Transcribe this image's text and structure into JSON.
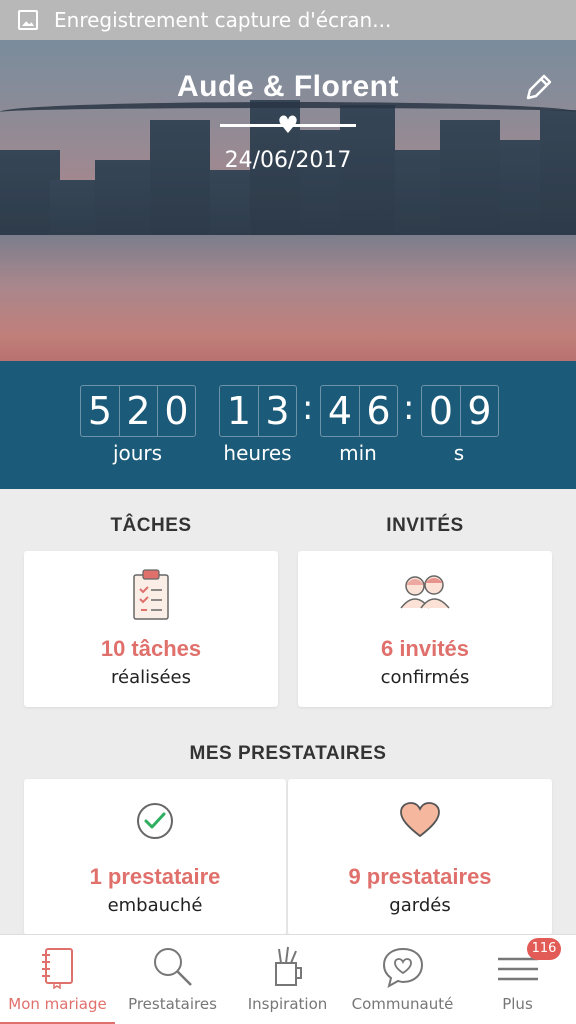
{
  "status_bar": {
    "text": "Enregistrement capture d'écran..."
  },
  "hero": {
    "couple": "Aude & Florent",
    "date": "24/06/2017"
  },
  "countdown": {
    "days": [
      "5",
      "2",
      "0"
    ],
    "hours": [
      "1",
      "3"
    ],
    "minutes": [
      "4",
      "6"
    ],
    "seconds": [
      "0",
      "9"
    ],
    "labels": {
      "days": "jours",
      "hours": "heures",
      "minutes": "min",
      "seconds": "s"
    }
  },
  "tasks": {
    "title": "TÂCHES",
    "count": "10 tâches",
    "subtitle": "réalisées"
  },
  "guests": {
    "title": "INVITÉS",
    "count": "6 invités",
    "subtitle": "confirmés"
  },
  "vendors": {
    "title": "MES PRESTATAIRES",
    "hired": {
      "count": "1 prestataire",
      "subtitle": "embauché"
    },
    "saved": {
      "count": "9 prestataires",
      "subtitle": "gardés"
    }
  },
  "nav": {
    "items": [
      {
        "label": "Mon mariage",
        "icon": "notebook-icon"
      },
      {
        "label": "Prestataires",
        "icon": "search-icon"
      },
      {
        "label": "Inspiration",
        "icon": "pencil-cup-icon"
      },
      {
        "label": "Communauté",
        "icon": "chat-heart-icon"
      },
      {
        "label": "Plus",
        "icon": "menu-icon"
      }
    ],
    "badge": "116"
  },
  "colors": {
    "accent": "#e0706c",
    "countdown_bg": "#1b5b79",
    "status_bar": "#b8b8b8"
  }
}
